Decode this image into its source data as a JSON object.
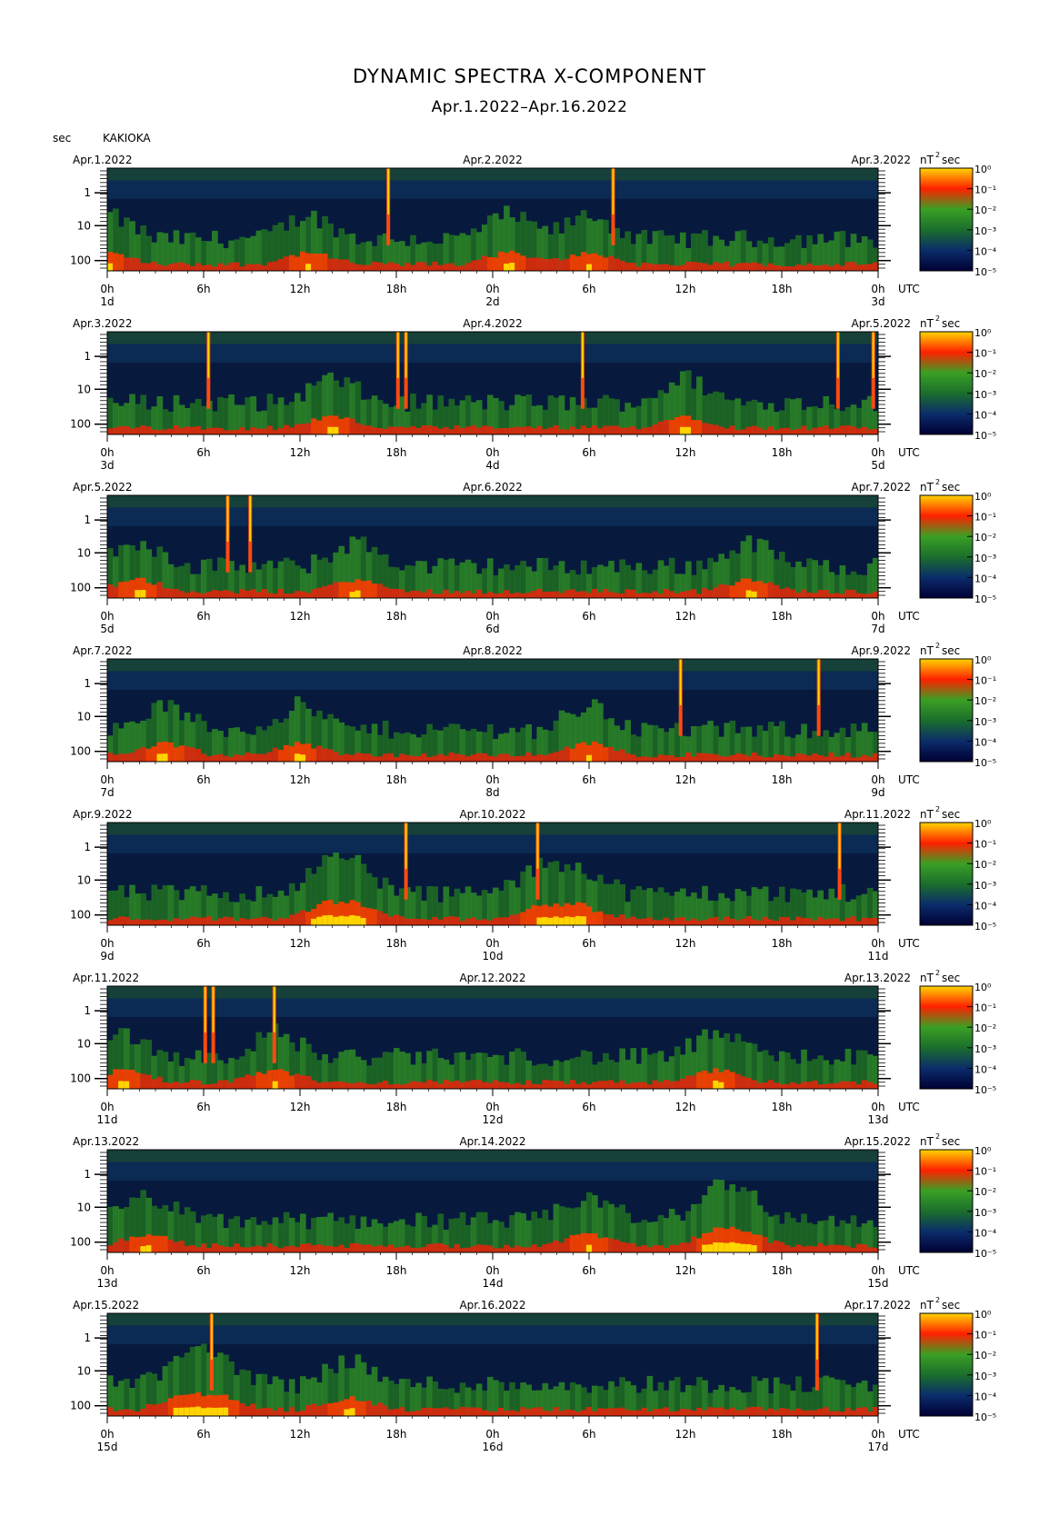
{
  "header": {
    "title": "DYNAMIC SPECTRA X-COMPONENT",
    "subtitle": "Apr.1.2022–Apr.16.2022",
    "period_unit": "sec",
    "station": "KAKIOKA"
  },
  "chart_data": {
    "type": "heatmap",
    "title": "DYNAMIC SPECTRA X-COMPONENT",
    "subtitle": "Apr.1.2022–Apr.16.2022",
    "ylabel": "sec",
    "y_scale": "log",
    "y_ticks": [
      "1",
      "10",
      "100"
    ],
    "x_ticks": [
      "0h",
      "6h",
      "12h",
      "18h",
      "0h",
      "6h",
      "12h",
      "18h",
      "0h"
    ],
    "x_unit": "UTC",
    "colorbar_unit": "nT²sec",
    "colorbar_ticks": [
      "10⁰",
      "10⁻¹",
      "10⁻²",
      "10⁻³",
      "10⁻⁴",
      "10⁻⁵"
    ],
    "colormap": [
      "#000033",
      "#0b2c6b",
      "#1b6e2c",
      "#3aa024",
      "#ff2000",
      "#ffd400"
    ],
    "panels": [
      {
        "left_date": "Apr.1.2022",
        "mid_date": "Apr.2.2022",
        "right_date": "Apr.3.2022",
        "days": [
          "1d",
          "2d",
          "3d"
        ],
        "spikes_hours": [
          17.5,
          31.5
        ],
        "activity_hours": [
          0,
          12.5,
          25,
          30
        ]
      },
      {
        "left_date": "Apr.3.2022",
        "mid_date": "Apr.4.2022",
        "right_date": "Apr.5.2022",
        "days": [
          "3d",
          "4d",
          "5d"
        ],
        "spikes_hours": [
          6.3,
          18.1,
          18.6,
          29.6,
          45.5,
          47.7
        ],
        "activity_hours": [
          14,
          36
        ]
      },
      {
        "left_date": "Apr.5.2022",
        "mid_date": "Apr.6.2022",
        "right_date": "Apr.7.2022",
        "days": [
          "5d",
          "6d",
          "7d"
        ],
        "spikes_hours": [
          7.5,
          8.9
        ],
        "activity_hours": [
          2,
          15.5,
          40
        ]
      },
      {
        "left_date": "Apr.7.2022",
        "mid_date": "Apr.8.2022",
        "right_date": "Apr.9.2022",
        "days": [
          "7d",
          "8d",
          "9d"
        ],
        "spikes_hours": [
          35.7,
          44.3
        ],
        "activity_hours": [
          3.5,
          12,
          30
        ]
      },
      {
        "left_date": "Apr.9.2022",
        "mid_date": "Apr.10.2022",
        "right_date": "Apr.11.2022",
        "days": [
          "9d",
          "10d",
          "11d"
        ],
        "spikes_hours": [
          18.6,
          26.8,
          45.6
        ],
        "activity_hours": [
          13.5,
          15.5,
          27,
          29.5
        ]
      },
      {
        "left_date": "Apr.11.2022",
        "mid_date": "Apr.12.2022",
        "right_date": "Apr.13.2022",
        "days": [
          "11d",
          "12d",
          "13d"
        ],
        "spikes_hours": [
          6.1,
          6.6,
          10.4
        ],
        "activity_hours": [
          1,
          10.5,
          38
        ]
      },
      {
        "left_date": "Apr.13.2022",
        "mid_date": "Apr.14.2022",
        "right_date": "Apr.15.2022",
        "days": [
          "13d",
          "14d",
          "15d"
        ],
        "spikes_hours": [],
        "activity_hours": [
          2.5,
          30,
          37.8,
          39.5
        ]
      },
      {
        "left_date": "Apr.15.2022",
        "mid_date": "Apr.16.2022",
        "right_date": "Apr.17.2022",
        "days": [
          "15d",
          "16d",
          "17d"
        ],
        "spikes_hours": [
          6.5,
          44.2
        ],
        "activity_hours": [
          4.8,
          7,
          15
        ]
      }
    ]
  }
}
